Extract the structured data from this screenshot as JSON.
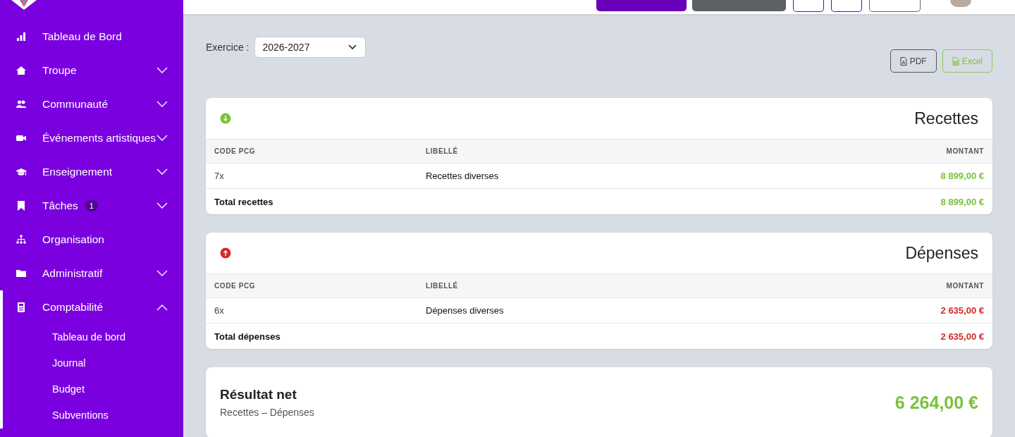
{
  "sidebar": {
    "items": [
      {
        "label": "Tableau de Bord",
        "kind": "link",
        "selected": false
      },
      {
        "label": "Troupe",
        "kind": "group",
        "expanded": false,
        "selected": false
      },
      {
        "label": "Communauté",
        "kind": "group",
        "expanded": false,
        "selected": false
      },
      {
        "label": "Événements artistiques",
        "kind": "group",
        "expanded": false,
        "selected": false
      },
      {
        "label": "Enseignement",
        "kind": "group",
        "expanded": false,
        "selected": false
      },
      {
        "label": "Tâches",
        "kind": "group",
        "expanded": false,
        "selected": false,
        "badge": "1"
      },
      {
        "label": "Organisation",
        "kind": "link",
        "selected": false
      },
      {
        "label": "Administratif",
        "kind": "group",
        "expanded": false,
        "selected": false
      },
      {
        "label": "Comptabilité",
        "kind": "group",
        "expanded": true,
        "selected": true,
        "children": [
          {
            "label": "Tableau de bord"
          },
          {
            "label": "Journal"
          },
          {
            "label": "Budget"
          },
          {
            "label": "Subventions"
          }
        ]
      }
    ]
  },
  "toolbar": {
    "exercice_label": "Exercice :",
    "exercice_value": "2026-2027",
    "exports": [
      {
        "label": "PDF",
        "kind": "pdf"
      },
      {
        "label": "Excel",
        "kind": "excel"
      }
    ]
  },
  "sections": [
    {
      "title": "Recettes",
      "kind": "income",
      "columns": [
        "CODE PCG",
        "LIBELLÉ",
        "MONTANT"
      ],
      "rows": [
        {
          "code": "7x",
          "label": "Recettes diverses",
          "amount": "8 899,00 €"
        }
      ],
      "total": {
        "label": "Total recettes",
        "amount": "8 899,00 €"
      }
    },
    {
      "title": "Dépenses",
      "kind": "expense",
      "columns": [
        "CODE PCG",
        "LIBELLÉ",
        "MONTANT"
      ],
      "rows": [
        {
          "code": "6x",
          "label": "Dépenses diverses",
          "amount": "2 635,00 €"
        }
      ],
      "total": {
        "label": "Total dépenses",
        "amount": "2 635,00 €"
      }
    }
  ],
  "result": {
    "title": "Résultat net",
    "subtitle": "Recettes – Dépenses",
    "amount": "6 264,00 €"
  }
}
